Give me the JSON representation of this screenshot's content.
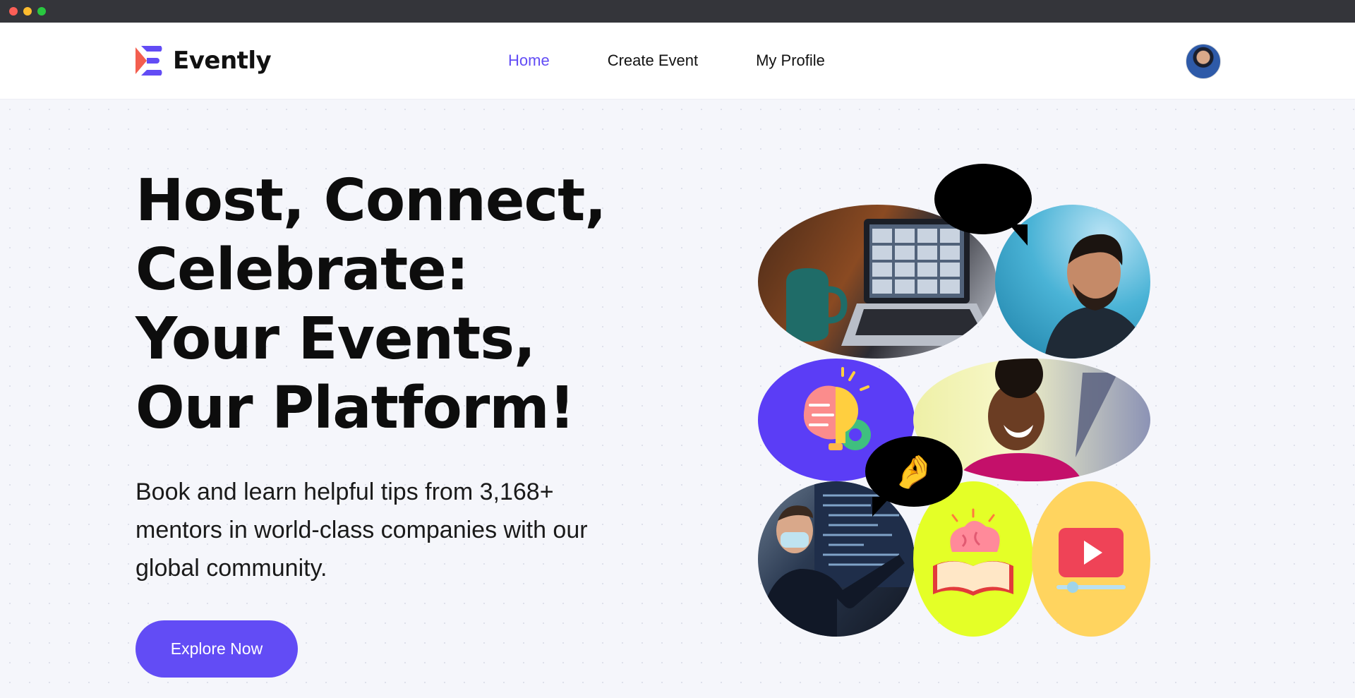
{
  "brand": {
    "name": "Evently",
    "accent": "#624cf5"
  },
  "nav": {
    "items": [
      {
        "label": "Home",
        "active": true
      },
      {
        "label": "Create Event",
        "active": false
      },
      {
        "label": "My Profile",
        "active": false
      }
    ]
  },
  "hero": {
    "title": "Host, Connect, Celebrate: Your Events, Our Platform!",
    "subtitle": "Book and learn helpful tips from 3,168+ mentors in world-class companies with our global community.",
    "cta_label": "Explore Now"
  },
  "collage": {
    "reactions": [
      "😍",
      "🤌"
    ]
  },
  "icons": {
    "user_avatar": "avatar",
    "idea": "brain-bulb-icon",
    "learning": "brain-book-icon",
    "video": "video-play-icon"
  }
}
